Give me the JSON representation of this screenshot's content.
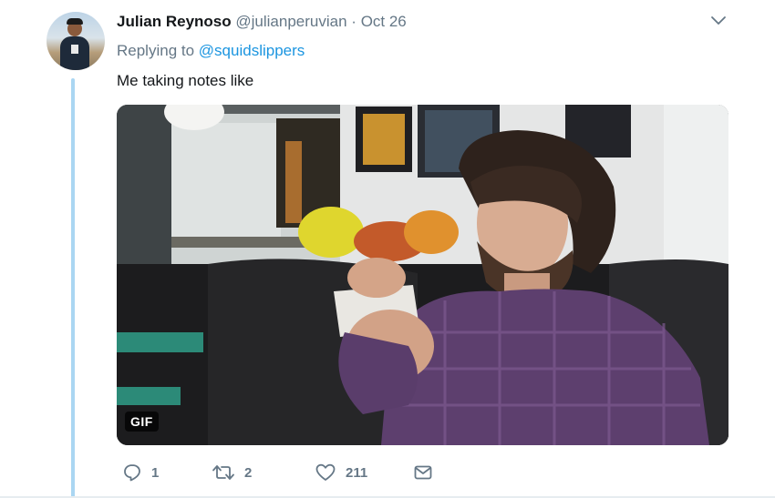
{
  "tweet": {
    "author_name": "Julian Reynoso",
    "author_handle": "@julianperuvian",
    "separator": "·",
    "date": "Oct 26",
    "replying_prefix": "Replying to",
    "replying_to": "@squidslippers",
    "text": "Me taking notes like",
    "media": {
      "badge": "GIF"
    },
    "actions": {
      "replies": "1",
      "retweets": "2",
      "likes": "211"
    }
  },
  "icons": {
    "menu": "chevron-down-icon",
    "reply": "reply-icon",
    "retweet": "retweet-icon",
    "like": "heart-icon",
    "message": "envelope-icon"
  },
  "colors": {
    "link": "#1b95e0",
    "secondary_text": "#657786",
    "thread_line": "#aad6f2"
  }
}
